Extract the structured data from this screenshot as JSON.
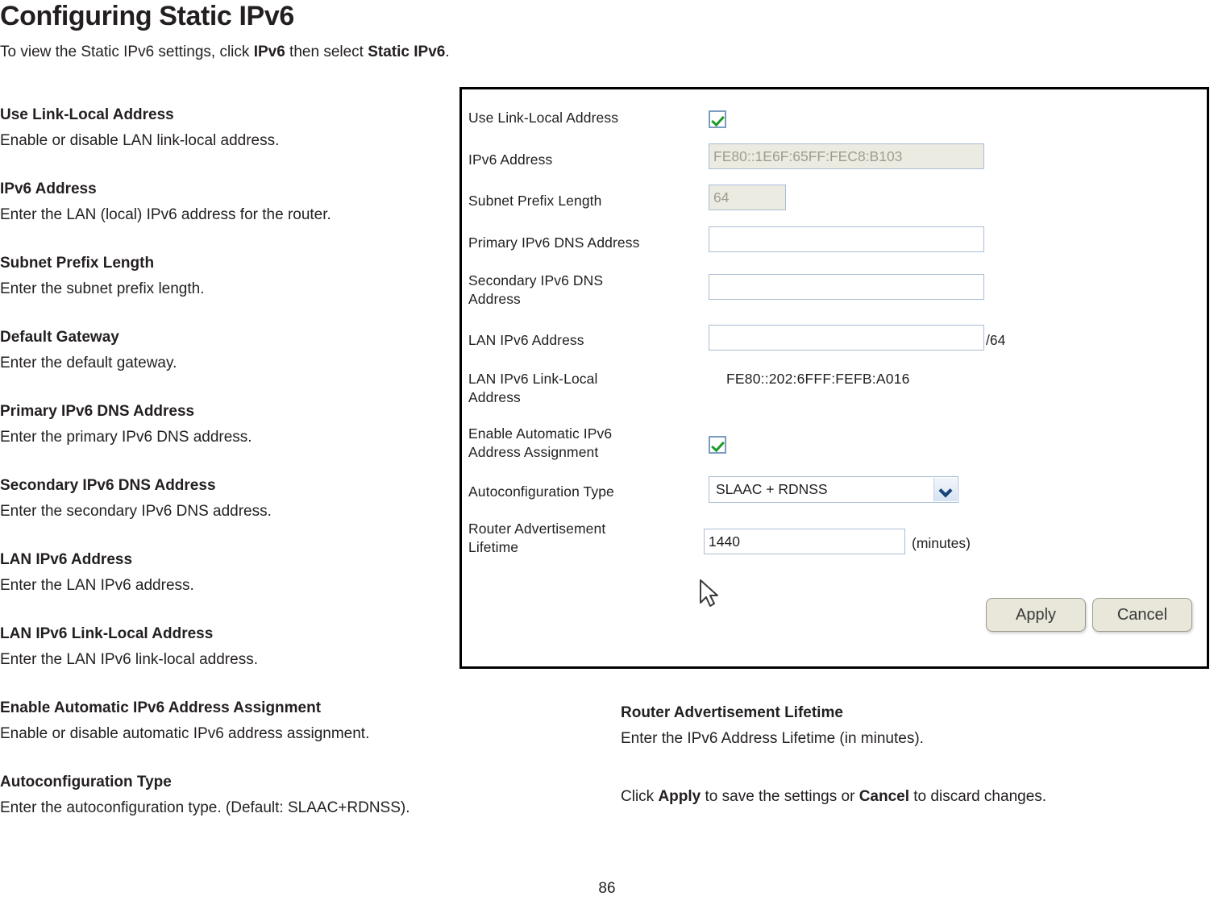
{
  "page": {
    "title": "Configuring Static IPv6",
    "subtitle_parts": {
      "a": "To view the Static IPv6 settings, click ",
      "b": "IPv6",
      "c": " then select ",
      "d": "Static IPv6",
      "e": "."
    },
    "folio": "86"
  },
  "left_column": [
    {
      "term": "Use Link-Local Address",
      "desc": "Enable or disable LAN link-local address."
    },
    {
      "term": "IPv6 Address",
      "desc": "Enter the LAN (local) IPv6 address for the router."
    },
    {
      "term": "Subnet Prefix Length",
      "desc": "Enter the subnet prefix length."
    },
    {
      "term": "Default Gateway",
      "desc": "Enter the default gateway."
    },
    {
      "term": "Primary IPv6 DNS Address",
      "desc": "Enter the primary IPv6 DNS address."
    },
    {
      "term": "Secondary IPv6 DNS Address",
      "desc": "Enter the secondary IPv6 DNS address."
    },
    {
      "term": "LAN IPv6 Address",
      "desc": "Enter the LAN IPv6 address."
    },
    {
      "term": "LAN IPv6 Link-Local Address",
      "desc": "Enter the LAN IPv6 link-local address."
    },
    {
      "term": "Enable Automatic IPv6 Address Assignment",
      "desc": "Enable or disable automatic IPv6 address assignment."
    },
    {
      "term": "Autoconfiguration Type",
      "desc": "Enter the autoconfiguration type. (Default: SLAAC+RDNSS)."
    }
  ],
  "right_column": {
    "term": "Router Advertisement Lifetime",
    "desc": "Enter the IPv6 Address Lifetime (in minutes).",
    "note_parts": {
      "a": "Click ",
      "b": "Apply",
      "c": " to save the settings or ",
      "d": "Cancel",
      "e": " to discard changes."
    }
  },
  "screenshot": {
    "rows": {
      "use_link_local": {
        "label": "Use Link-Local Address",
        "checked": true
      },
      "ipv6_address": {
        "label": "IPv6 Address",
        "value": "FE80::1E6F:65FF:FEC8:B103",
        "disabled": true
      },
      "subnet_prefix_length": {
        "label": "Subnet Prefix Length",
        "value": "64",
        "disabled": true
      },
      "primary_dns": {
        "label": "Primary IPv6 DNS Address",
        "value": ""
      },
      "secondary_dns": {
        "label": "Secondary IPv6 DNS Address",
        "value": ""
      },
      "lan_ipv6_address": {
        "label": "LAN IPv6 Address",
        "value": "",
        "suffix": "/64"
      },
      "lan_link_local": {
        "label": "LAN IPv6 Link-Local Address",
        "value": "FE80::202:6FFF:FEFB:A016"
      },
      "enable_auto_assign": {
        "label": "Enable Automatic IPv6 Address Assignment",
        "checked": true
      },
      "autoconfig_type": {
        "label": "Autoconfiguration Type",
        "value": "SLAAC + RDNSS"
      },
      "ra_lifetime": {
        "label": "Router Advertisement Lifetime",
        "value": "1440",
        "suffix": "(minutes)"
      }
    },
    "buttons": {
      "apply": "Apply",
      "cancel": "Cancel"
    }
  },
  "colors": {
    "text": "#231f20",
    "field_border": "#a9bdd4",
    "disabled_field_bg": "#ebebe1",
    "check_green": "#1f9b28",
    "button_bg": "#e9e7da",
    "panel_border": "#000000"
  }
}
